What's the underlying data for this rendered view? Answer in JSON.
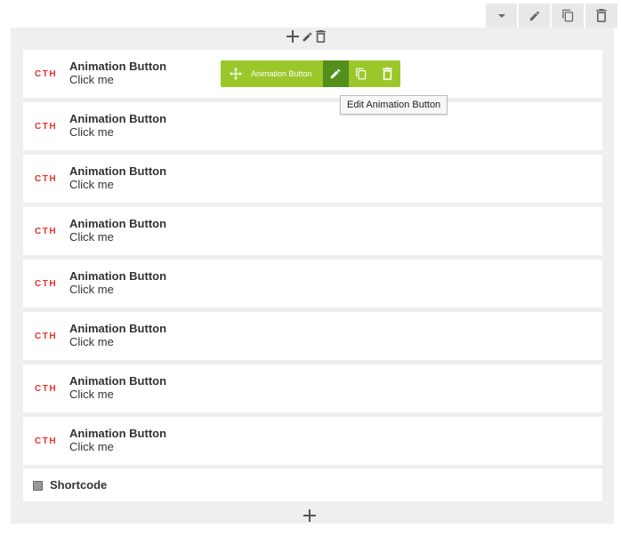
{
  "rows": [
    {
      "logo": "CTH",
      "title": "Animation Button",
      "subtitle": "Click me"
    },
    {
      "logo": "CTH",
      "title": "Animation Button",
      "subtitle": "Click me"
    },
    {
      "logo": "CTH",
      "title": "Animation Button",
      "subtitle": "Click me"
    },
    {
      "logo": "CTH",
      "title": "Animation Button",
      "subtitle": "Click me"
    },
    {
      "logo": "CTH",
      "title": "Animation Button",
      "subtitle": "Click me"
    },
    {
      "logo": "CTH",
      "title": "Animation Button",
      "subtitle": "Click me"
    },
    {
      "logo": "CTH",
      "title": "Animation Button",
      "subtitle": "Click me"
    },
    {
      "logo": "CTH",
      "title": "Animation Button",
      "subtitle": "Click me"
    }
  ],
  "shortcode": {
    "label": "Shortcode"
  },
  "element_toolbar": {
    "label": "Animation Button"
  },
  "tooltip": {
    "text": "Edit Animation Button"
  },
  "colors": {
    "accent_green": "#9cc72b",
    "active_green": "#548e1b",
    "logo_red": "#e8312a",
    "container_bg": "#efefef"
  },
  "icons": {
    "top_toolbar": [
      "caret-down-icon",
      "pencil-icon",
      "copy-icon",
      "trash-icon"
    ],
    "container_controls": [
      "plus-icon",
      "pencil-icon",
      "trash-icon"
    ],
    "element_toolbar": [
      "move-icon",
      "pencil-icon",
      "copy-icon",
      "trash-icon"
    ]
  }
}
